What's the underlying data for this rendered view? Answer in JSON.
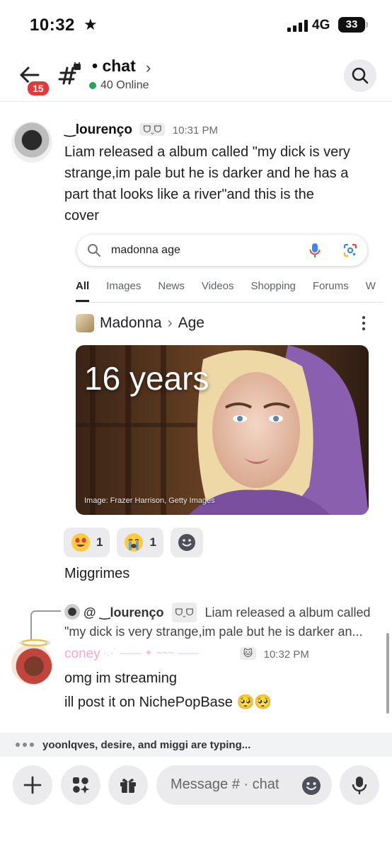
{
  "status": {
    "time": "10:32",
    "network": "4G",
    "battery": "33"
  },
  "header": {
    "notif_count": "15",
    "channel_name": "• chat",
    "chevron": "›",
    "online": "40 Online"
  },
  "message1": {
    "author": "‿lourenço",
    "tag": "ᗜˬᗜ",
    "time": "10:31 PM",
    "lines": [
      "Liam released a album called \"my dick is very",
      "strange,im pale but he is darker and he has a",
      "part that looks like a river\"and this is the",
      "cover"
    ]
  },
  "google": {
    "query": "madonna age",
    "tabs": [
      "All",
      "Images",
      "News",
      "Videos",
      "Shopping",
      "Forums",
      "W"
    ],
    "entity": "Madonna",
    "sep": "›",
    "attribute": "Age",
    "answer": "16 years",
    "credit": "Image: Frazer Harrison, Getty Images"
  },
  "reactions": [
    {
      "icon": "heart-eyes-emoji-icon",
      "count": "1"
    },
    {
      "icon": "crying-emoji-icon",
      "count": "1"
    }
  ],
  "followup": {
    "text": "Miggrimes"
  },
  "reply": {
    "ref_author": "@ ‿lourenço",
    "ref_tag": "ᗜˬᗜ",
    "ref_text_1": "Liam released a album called",
    "ref_text_2": "\"my dick is very strange,im pale but he is darker an...",
    "author": "coney",
    "tag": "🐱",
    "time": "10:32 PM",
    "lines": [
      "omg im streaming",
      "ill post it on NichePopBase 🥺🥺"
    ]
  },
  "typing": {
    "text": "yoonlqves, desire, and miggi are typing..."
  },
  "composer": {
    "placeholder": "Message # · chat"
  },
  "colors": {
    "online": "#23a55a",
    "badge": "#e5383b",
    "coney": "#f3a9d8",
    "mic": "#4285f4"
  }
}
